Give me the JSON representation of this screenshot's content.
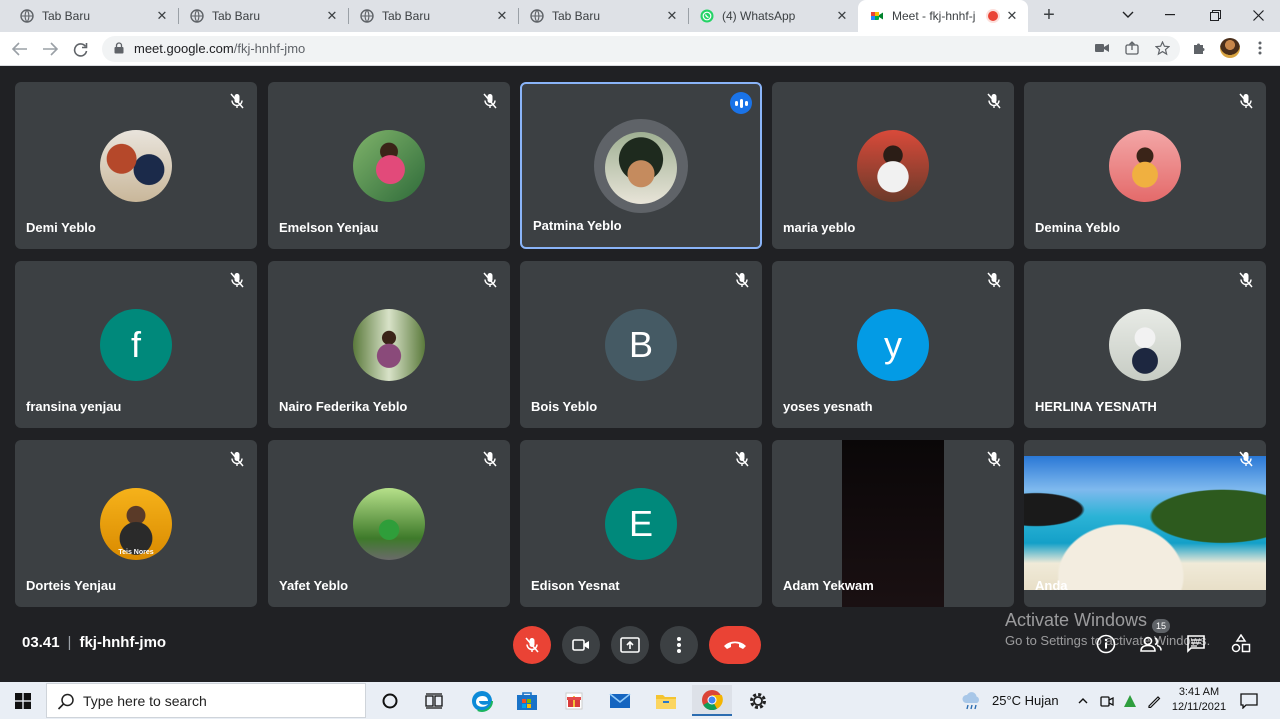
{
  "browser": {
    "tabs": [
      {
        "title": "Tab Baru",
        "favicon": "globe-icon"
      },
      {
        "title": "Tab Baru",
        "favicon": "globe-icon"
      },
      {
        "title": "Tab Baru",
        "favicon": "globe-icon"
      },
      {
        "title": "Tab Baru",
        "favicon": "globe-icon"
      },
      {
        "title": "(4) WhatsApp",
        "favicon": "whatsapp-icon"
      },
      {
        "title": "Meet - fkj-hnhf-jı",
        "favicon": "meet-icon",
        "recording": true,
        "active": true
      }
    ],
    "url_host": "meet.google.com",
    "url_path": "/fkj-hnhf-jmo"
  },
  "meet": {
    "participants": [
      {
        "name": "Demi Yeblo",
        "avatar": "photo",
        "muted": true
      },
      {
        "name": "Emelson Yenjau",
        "avatar": "photo",
        "muted": true
      },
      {
        "name": "Patmina Yeblo",
        "avatar": "photo",
        "speaking": true
      },
      {
        "name": "maria yeblo",
        "avatar": "photo",
        "muted": true
      },
      {
        "name": "Demina Yeblo",
        "avatar": "photo",
        "muted": true
      },
      {
        "name": "fransina yenjau",
        "avatar_letter": "f",
        "avatar_color": "#00897b",
        "muted": true
      },
      {
        "name": "Nairo Federika Yeblo",
        "avatar": "photo",
        "muted": true
      },
      {
        "name": "Bois Yeblo",
        "avatar_letter": "B",
        "avatar_color": "#455a64",
        "muted": true
      },
      {
        "name": "yoses yesnath",
        "avatar_letter": "y",
        "avatar_color": "#039be5",
        "muted": true
      },
      {
        "name": "HERLINA YESNATH",
        "avatar": "photo",
        "muted": true
      },
      {
        "name": "Dorteis Yenjau",
        "avatar": "photo",
        "avatar_caption": "Teis Nores",
        "muted": true
      },
      {
        "name": "Yafet Yeblo",
        "avatar": "photo",
        "muted": true
      },
      {
        "name": "Edison Yesnat",
        "avatar_letter": "E",
        "avatar_color": "#00897b",
        "muted": true
      },
      {
        "name": "Adam Yekwam",
        "avatar": "video",
        "muted": true
      },
      {
        "name": "Anda",
        "avatar": "video",
        "muted": true
      }
    ],
    "time": "03.41",
    "separator": "|",
    "code": "fkj-hnhf-jmo",
    "people_count": "15"
  },
  "activation": {
    "title": "Activate Windows",
    "subtitle": "Go to Settings to activate Windows."
  },
  "taskbar": {
    "search_placeholder": "Type here to search",
    "weather": "25°C  Hujan",
    "time": "3:41 AM",
    "date": "12/11/2021"
  },
  "colors": {
    "meet_bg": "#202124",
    "tile_bg": "#3c4043",
    "accent_blue": "#1a73e8",
    "hangup_red": "#ea4335"
  }
}
